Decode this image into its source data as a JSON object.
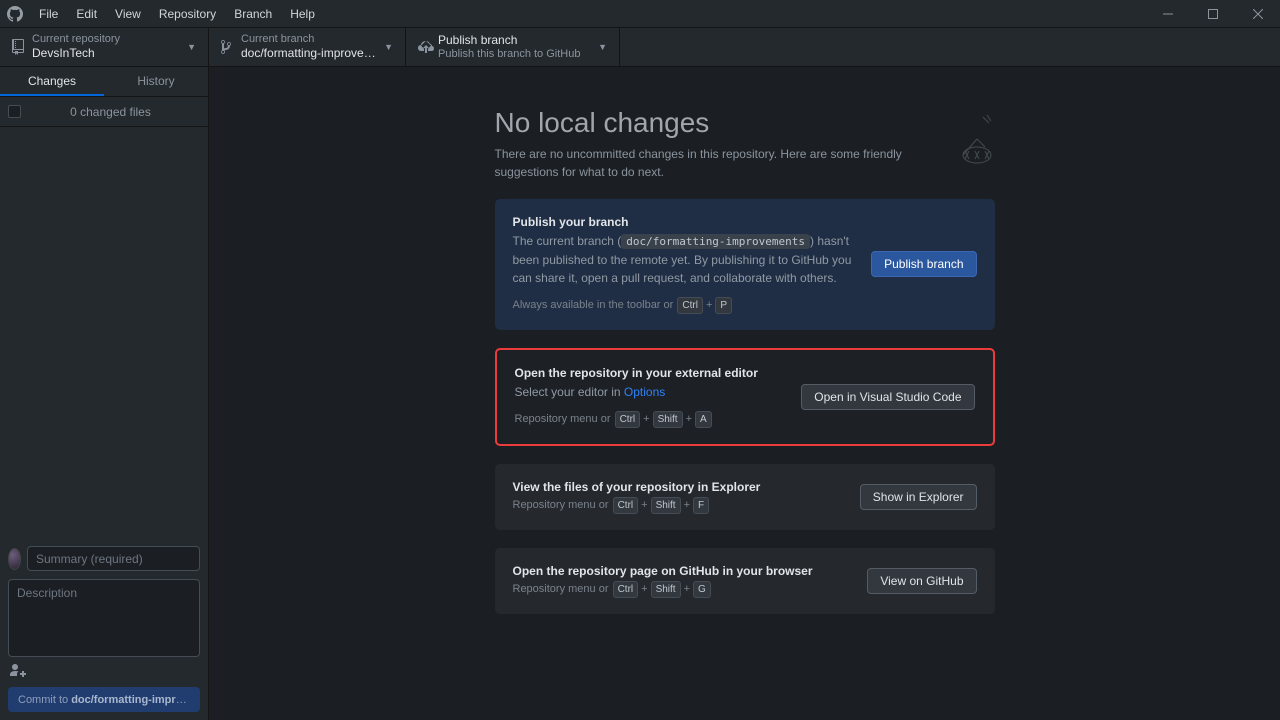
{
  "menu": {
    "file": "File",
    "edit": "Edit",
    "view": "View",
    "repository": "Repository",
    "branch": "Branch",
    "help": "Help"
  },
  "toolbar": {
    "repo_label": "Current repository",
    "repo_value": "DevsInTech",
    "branch_label": "Current branch",
    "branch_value": "doc/formatting-improvem...",
    "publish_label": "Publish branch",
    "publish_hint": "Publish this branch to GitHub"
  },
  "tabs": {
    "changes": "Changes",
    "history": "History"
  },
  "changed_files": "0 changed files",
  "commit": {
    "summary_ph": "Summary (required)",
    "desc_ph": "Description",
    "button_prefix": "Commit to ",
    "button_branch": "doc/formatting-improv..."
  },
  "main": {
    "heading": "No local changes",
    "sub": "There are no uncommitted changes in this repository. Here are some friendly suggestions for what to do next."
  },
  "cards": {
    "publish": {
      "title": "Publish your branch",
      "desc_pre": "The current branch (",
      "desc_code": "doc/formatting-improvements",
      "desc_post": ") hasn't been published to the remote yet. By publishing it to GitHub you can share it, open a pull request, and collaborate with others.",
      "hint_pre": "Always available in the toolbar or",
      "k1": "Ctrl",
      "k2": "P",
      "btn": "Publish branch"
    },
    "editor": {
      "title": "Open the repository in your external editor",
      "desc_pre": "Select your editor in ",
      "link": "Options",
      "hint_pre": "Repository menu or",
      "k1": "Ctrl",
      "k2": "Shift",
      "k3": "A",
      "btn": "Open in Visual Studio Code"
    },
    "explorer": {
      "title": "View the files of your repository in Explorer",
      "hint_pre": "Repository menu or",
      "k1": "Ctrl",
      "k2": "Shift",
      "k3": "F",
      "btn": "Show in Explorer"
    },
    "github": {
      "title": "Open the repository page on GitHub in your browser",
      "hint_pre": "Repository menu or",
      "k1": "Ctrl",
      "k2": "Shift",
      "k3": "G",
      "btn": "View on GitHub"
    }
  }
}
